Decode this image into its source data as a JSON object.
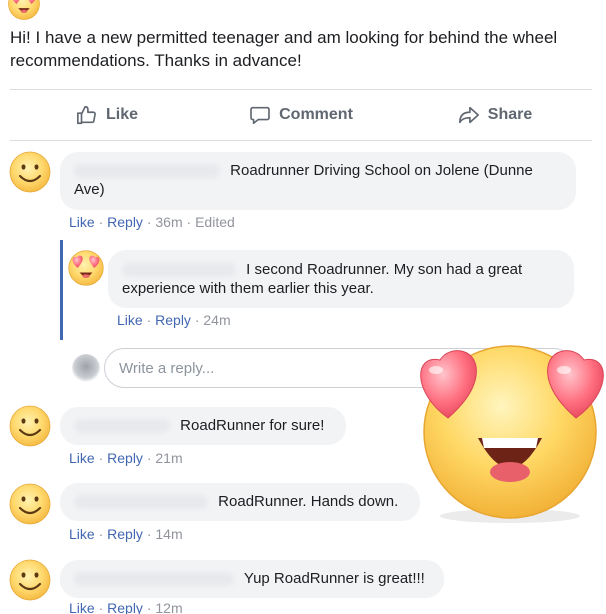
{
  "post": {
    "text": "Hi! I have a new permitted teenager and am looking for behind the wheel recommendations. Thanks in advance!"
  },
  "actions": {
    "like": "Like",
    "comment": "Comment",
    "share": "Share"
  },
  "comments": [
    {
      "text": "Roadrunner Driving School on Jolene (Dunne Ave)",
      "like": "Like",
      "reply": "Reply",
      "time": "36m",
      "edited": "Edited"
    },
    {
      "text": "I second Roadrunner. My son had a great experience with them earlier this year.",
      "like": "Like",
      "reply": "Reply",
      "time": "24m"
    },
    {
      "text": "RoadRunner for sure!",
      "like": "Like",
      "reply": "Reply",
      "time": "21m"
    },
    {
      "text": "RoadRunner. Hands down.",
      "like": "Like",
      "reply": "Reply",
      "time": "14m"
    },
    {
      "text": "Yup RoadRunner is great!!!",
      "like": "Like",
      "reply": "Reply",
      "time": "12m"
    }
  ],
  "reply_box": {
    "placeholder": "Write a reply..."
  },
  "colors": {
    "link": "#4267b2",
    "meta": "#90949c",
    "bubble": "#f2f3f5",
    "thread_line": "#4267b2",
    "emoji_face": "#ffd46b",
    "heart": "#ff6b7a"
  },
  "icons": {
    "like": "thumbs-up-icon",
    "comment": "speech-bubble-icon",
    "share": "share-arrow-icon",
    "avatar_smile": "smiley-emoji",
    "avatar_heart_eyes": "heart-eyes-emoji"
  }
}
